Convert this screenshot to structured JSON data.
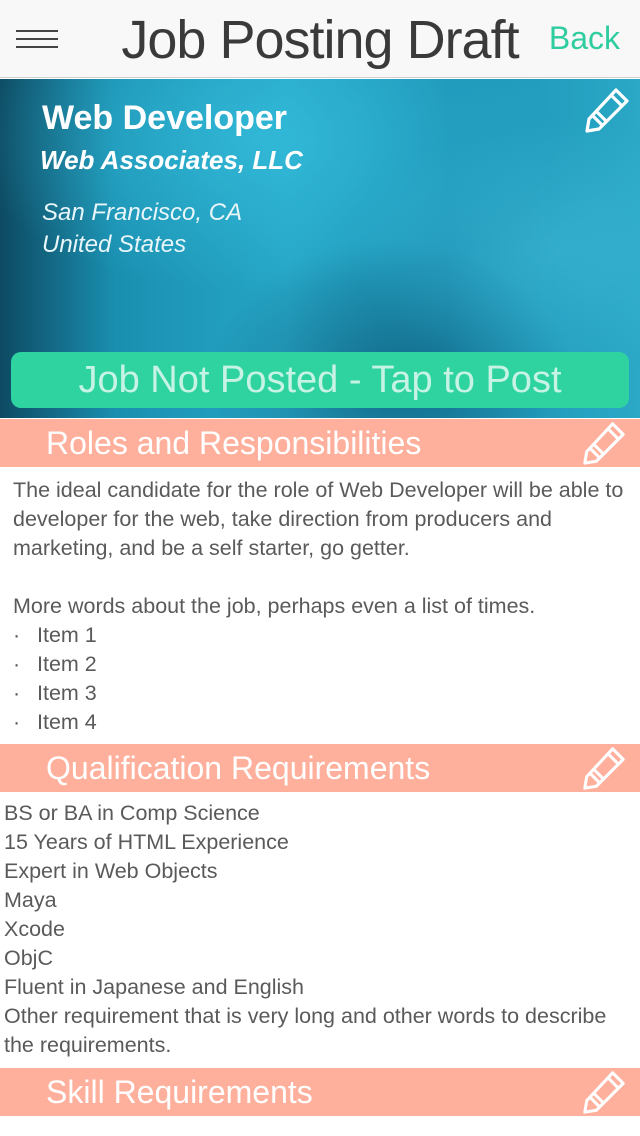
{
  "nav": {
    "title": "Job Posting Draft",
    "back_label": "Back",
    "menu_icon": "hamburger-menu-icon"
  },
  "hero": {
    "job_title": "Web Developer",
    "company": "Web Associates, LLC",
    "city": "San Francisco, CA",
    "country": "United States",
    "edit_icon": "pencil-icon",
    "post_button_label": "Job Not Posted - Tap to Post"
  },
  "roles": {
    "header": "Roles and Responsibilities",
    "paragraph1": "The ideal candidate for the role of Web Developer will be able to developer for the web, take direction from producers and marketing, and be a self starter, go getter.",
    "paragraph2": "More words about the job, perhaps even a list of times.",
    "bullet": "·",
    "items": [
      "Item 1",
      "Item 2",
      "Item 3",
      "Item 4"
    ]
  },
  "qualifications": {
    "header": "Qualification Requirements",
    "items": [
      "BS or BA in Comp Science",
      "15 Years of HTML Experience",
      "Expert in Web Objects",
      "Maya",
      "Xcode",
      "ObjC",
      "Fluent in Japanese and English",
      "Other requirement that is very long and other words to describe the requirements."
    ]
  },
  "skills": {
    "header": "Skill Requirements"
  },
  "colors": {
    "accent_green": "#2ecc9f",
    "post_button": "#2ed3a0",
    "section_header": "#ffb09c",
    "hero_blue": "#1d94b6"
  }
}
